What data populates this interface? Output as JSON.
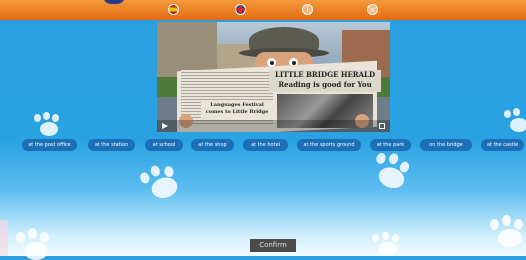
{
  "toolbar": {
    "language_es": "Spanish flag",
    "language_en": "UK flag",
    "info_icon": "i",
    "close_icon": "×"
  },
  "video": {
    "newspaper_title": "LITTLE BRIDGE HERALD",
    "newspaper_subtitle": "Reading is good for You",
    "story_headline": "Languages Festival comes to Little Bridge"
  },
  "options": [
    "at the post office",
    "at the station",
    "at school",
    "at the shop",
    "at the hotel",
    "at the sports ground",
    "at the park",
    "on the bridge",
    "at the castle"
  ],
  "confirm_label": "Confirm",
  "colors": {
    "header": "#e36a12",
    "background": "#2b9ee0",
    "option_pill": "#1b6fb7",
    "confirm": "#4b4b4b"
  }
}
